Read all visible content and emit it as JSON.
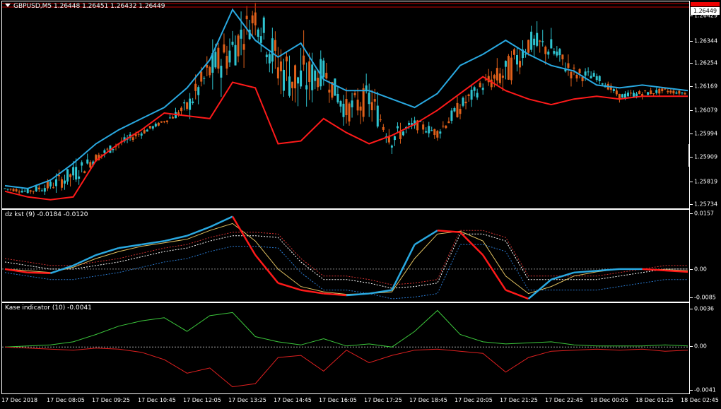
{
  "main": {
    "title": "GBPUSD,M5  1.26448 1.26451 1.26432 1.26449",
    "current_price": "1.26449",
    "y_labels": [
      "1.26429",
      "1.26344",
      "1.26254",
      "1.26169",
      "1.26079",
      "1.25994",
      "1.25909",
      "1.25819",
      "1.25734"
    ],
    "colors": {
      "up_line": "#29a8e0",
      "down_line": "#ff1a1a",
      "bull_candle": "#2ec4d0",
      "bear_candle": "#e0601a"
    }
  },
  "kst": {
    "title": "dz kst (9) -0.0184 -0.0120",
    "y_labels": [
      "0.0157",
      "0.00",
      "-0.0085"
    ]
  },
  "kase": {
    "title": "Kase indicator (10) -0.0041",
    "y_labels": [
      "0.0036",
      "0.00",
      "-0.0041"
    ]
  },
  "x_labels": [
    "17 Dec 2018",
    "17 Dec 08:05",
    "17 Dec 09:25",
    "17 Dec 10:45",
    "17 Dec 12:05",
    "17 Dec 13:25",
    "17 Dec 14:45",
    "17 Dec 16:05",
    "17 Dec 17:25",
    "17 Dec 18:45",
    "17 Dec 20:05",
    "17 Dec 21:25",
    "17 Dec 22:45",
    "18 Dec 00:05",
    "18 Dec 01:25",
    "18 Dec 02:45"
  ],
  "chart_data": [
    {
      "type": "line",
      "title": "GBPUSD,M5",
      "x": [
        0,
        16,
        33,
        50,
        66,
        83,
        100,
        116,
        133,
        150,
        166,
        183,
        200,
        216,
        233,
        250,
        266,
        283,
        300,
        316,
        333,
        350,
        366,
        383,
        400,
        416,
        433,
        450,
        466,
        483,
        500
      ],
      "series": [
        {
          "values": [
            1.258,
            1.2579,
            1.2581,
            1.2585,
            1.2591,
            1.2596,
            1.26,
            1.2604,
            1.2609,
            1.2622,
            1.263,
            1.2642,
            1.2624,
            1.2618,
            1.2622,
            1.2608,
            1.2612,
            1.2598,
            1.2603,
            1.26,
            1.2609,
            1.2617,
            1.2621,
            1.2632,
            1.263,
            1.2621,
            1.262,
            1.2613,
            1.2614,
            1.2615,
            1.2614
          ]
        }
      ],
      "upper_envelope": [
        1.2581,
        1.258,
        1.2583,
        1.2589,
        1.2596,
        1.2601,
        1.2605,
        1.2609,
        1.2616,
        1.2626,
        1.2644,
        1.2633,
        1.2627,
        1.2632,
        1.2619,
        1.2615,
        1.2615,
        1.2612,
        1.2609,
        1.2614,
        1.2624,
        1.2628,
        1.2633,
        1.2628,
        1.2624,
        1.2622,
        1.2617,
        1.2616,
        1.2617,
        1.2616,
        1.2615
      ],
      "lower_envelope": [
        1.2579,
        1.2577,
        1.2576,
        1.2577,
        1.259,
        1.2596,
        1.2601,
        1.2607,
        1.2606,
        1.2605,
        1.2618,
        1.2616,
        1.2596,
        1.2597,
        1.2605,
        1.26,
        1.2596,
        1.2599,
        1.2603,
        1.2608,
        1.2614,
        1.262,
        1.2615,
        1.2612,
        1.261,
        1.2612,
        1.2613,
        1.2612,
        1.2613,
        1.2613,
        1.2613
      ],
      "ylim": [
        1.25734,
        1.26449
      ]
    },
    {
      "type": "line",
      "title": "dz kst (9)",
      "x": [
        0,
        16,
        33,
        50,
        66,
        83,
        100,
        116,
        133,
        150,
        166,
        183,
        200,
        216,
        233,
        250,
        266,
        283,
        300,
        316,
        333,
        350,
        366,
        383,
        400,
        416,
        433,
        450,
        466,
        483,
        500
      ],
      "series": [
        {
          "values": [
            0.0,
            -0.001,
            -0.0012,
            0.001,
            0.004,
            0.006,
            0.007,
            0.008,
            0.0095,
            0.012,
            0.015,
            0.004,
            -0.004,
            -0.006,
            -0.007,
            -0.0075,
            -0.007,
            -0.006,
            0.007,
            0.011,
            0.0105,
            0.004,
            -0.006,
            -0.0085,
            -0.003,
            -0.001,
            -0.0005,
            0.0,
            0.0,
            -0.0004,
            -0.0008
          ]
        },
        {
          "values": [
            0.0,
            -0.0005,
            -0.001,
            0.0005,
            0.003,
            0.005,
            0.0065,
            0.0075,
            0.0085,
            0.011,
            0.013,
            0.008,
            0.0,
            -0.005,
            -0.0065,
            -0.0072,
            -0.007,
            -0.0065,
            0.003,
            0.01,
            0.0108,
            0.008,
            -0.002,
            -0.007,
            -0.005,
            -0.002,
            -0.0008,
            0.0,
            0.0,
            -0.0002,
            -0.0005
          ]
        },
        {
          "values": [
            0.002,
            0.001,
            0.0,
            0.0,
            0.001,
            0.002,
            0.0035,
            0.005,
            0.006,
            0.008,
            0.0095,
            0.0095,
            0.009,
            0.002,
            -0.003,
            -0.003,
            -0.004,
            -0.0055,
            -0.005,
            -0.004,
            0.01,
            0.01,
            0.008,
            -0.003,
            -0.003,
            -0.003,
            -0.003,
            -0.002,
            -0.001,
            0.0,
            0.0
          ]
        }
      ],
      "ylim": [
        -0.0085,
        0.0157
      ]
    },
    {
      "type": "line",
      "title": "Kase indicator (10)",
      "x": [
        0,
        16,
        33,
        50,
        66,
        83,
        100,
        116,
        133,
        150,
        166,
        183,
        200,
        216,
        233,
        250,
        266,
        283,
        300,
        316,
        333,
        350,
        366,
        383,
        400,
        416,
        433,
        450,
        466,
        483,
        500
      ],
      "series": [
        {
          "values": [
            0.0,
            0.0001,
            0.0002,
            0.0005,
            0.0012,
            0.002,
            0.0025,
            0.0028,
            0.0015,
            0.003,
            0.0033,
            0.001,
            0.0005,
            0.0002,
            0.0008,
            0.0001,
            0.0003,
            0.0,
            0.0015,
            0.0035,
            0.0012,
            0.0005,
            0.0003,
            0.0004,
            0.0005,
            0.0002,
            0.0001,
            0.0001,
            0.0001,
            0.0002,
            0.0001
          ]
        },
        {
          "values": [
            0.0,
            -0.0001,
            -0.0002,
            -0.0003,
            -0.0001,
            -0.0002,
            -0.0005,
            -0.0012,
            -0.0025,
            -0.002,
            -0.0038,
            -0.0035,
            -0.001,
            -0.0008,
            -0.0023,
            -0.0003,
            -0.0015,
            -0.0008,
            -0.0003,
            -0.0002,
            -0.0004,
            -0.0006,
            -0.0024,
            -0.001,
            -0.0004,
            -0.0003,
            -0.0002,
            -0.0003,
            -0.0002,
            -0.0004,
            -0.0003
          ]
        }
      ],
      "ylim": [
        -0.0041,
        0.0036
      ]
    }
  ]
}
